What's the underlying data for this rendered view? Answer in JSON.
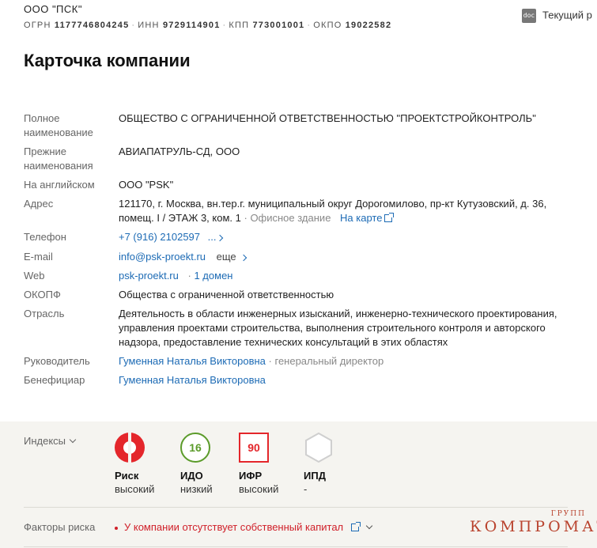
{
  "header": {
    "company_short": "ООО \"ПСК\"",
    "ogrn_label": "ОГРН",
    "ogrn": "1177746804245",
    "inn_label": "ИНН",
    "inn": "9729114901",
    "kpp_label": "КПП",
    "kpp": "773001001",
    "okpo_label": "ОКПО",
    "okpo": "19022582",
    "separator": "·",
    "doc_icon": "doc",
    "doc_link": "Текущий р"
  },
  "card": {
    "title": "Карточка компании",
    "full_name_label": "Полное наименование",
    "full_name": "ОБЩЕСТВО С ОГРАНИЧЕННОЙ ОТВЕТСТВЕННОСТЬЮ \"ПРОЕКТСТРОЙКОНТРОЛЬ\"",
    "former_names_label": "Прежние наименования",
    "former_names": "АВИАПАТРУЛЬ-СД, ООО",
    "english_label": "На английском",
    "english": "ООО \"PSK\"",
    "address_label": "Адрес",
    "address": "121170, г. Москва, вн.тер.г. муниципальный округ Дорогомилово, пр-кт Кутузовский, д. 36, помещ. I / ЭТАЖ 3, ком. 1",
    "address_type": "Офисное здание",
    "map_link": "На карте",
    "phone_label": "Телефон",
    "phone": "+7 (916) 2102597",
    "phone_more": "...",
    "email_label": "E-mail",
    "email": "info@psk-proekt.ru",
    "email_more": "еще",
    "web_label": "Web",
    "web": "psk-proekt.ru",
    "web_domains": "1 домен",
    "okopf_label": "ОКОПФ",
    "okopf": "Общества с ограниченной ответственностью",
    "industry_label": "Отрасль",
    "industry": "Деятельность в области инженерных изысканий, инженерно-технического проектирования, управления проектами строительства, выполнения строительного контроля и авторского надзора, предоставление технических консультаций в этих областях",
    "director_label": "Руководитель",
    "director": "Гуменная Наталья Викторовна",
    "director_role": "генеральный директор",
    "beneficiary_label": "Бенефициар",
    "beneficiary": "Гуменная Наталья Викторовна"
  },
  "indices": {
    "label": "Индексы",
    "items": [
      {
        "name": "Риск",
        "value": "",
        "sub": "высокий",
        "icon": "risk-ring-icon",
        "color": "#e4262b"
      },
      {
        "name": "ИДО",
        "value": "16",
        "sub": "низкий",
        "icon": "ido-circle-icon",
        "color": "#5b9b2a"
      },
      {
        "name": "ИФР",
        "value": "90",
        "sub": "высокий",
        "icon": "ifr-square-icon",
        "color": "#e4262b"
      },
      {
        "name": "ИПД",
        "value": "",
        "sub": "-",
        "icon": "ipd-hexagon-icon",
        "color": "#cfcfcf"
      }
    ],
    "risk_factors_label": "Факторы риска",
    "risk_factor": "У компании отсутствует собственный капитал"
  },
  "watermark": {
    "small": "ГРУПП",
    "main": "КОМПРОМАТ"
  }
}
